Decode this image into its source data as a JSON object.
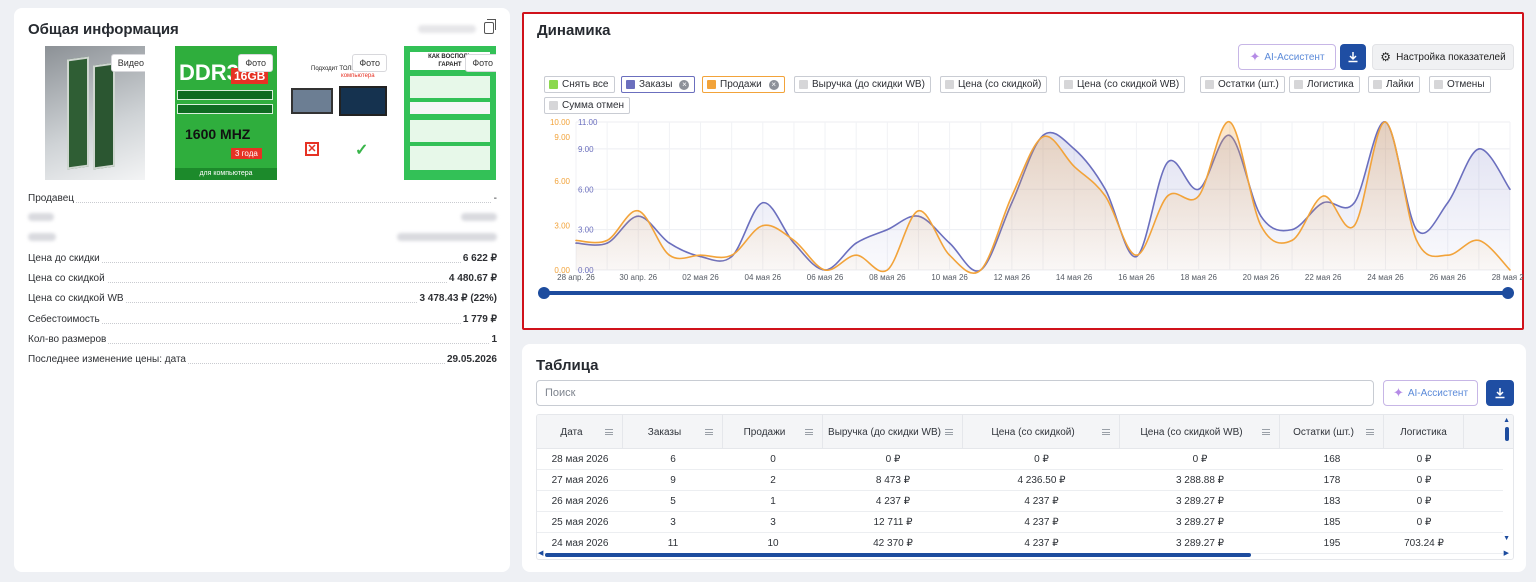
{
  "info": {
    "title": "Общая информация",
    "photos": [
      {
        "tag": "Видео"
      },
      {
        "tag": "Фото",
        "product_text": [
          "DDR3",
          "16GB",
          "1600 MHZ",
          "3 года",
          "для компьютера"
        ]
      },
      {
        "tag": "Фото",
        "product_text": [
          "Подходит ТОЛЬКО для",
          "компьютера"
        ]
      },
      {
        "tag": "Фото",
        "product_text": [
          "КАК ВОСПОЛЬ",
          "ГАРАНТ"
        ]
      }
    ],
    "rows": [
      {
        "label": "Продавец",
        "value": "-"
      },
      {
        "label": "",
        "value": "",
        "blurred": true
      },
      {
        "label": "",
        "value": "",
        "blurred": true
      },
      {
        "label": "Цена до скидки",
        "value": "6 622 ₽"
      },
      {
        "label": "Цена со скидкой",
        "value": "4 480.67 ₽"
      },
      {
        "label": "Цена со скидкой WB",
        "value": "3 478.43 ₽ (22%)"
      },
      {
        "label": "Себестоимость",
        "value": "1 779 ₽"
      },
      {
        "label": "Кол-во размеров",
        "value": "1"
      },
      {
        "label": "Последнее изменение цены: дата",
        "value": "29.05.2026"
      }
    ]
  },
  "dynamics": {
    "title": "Динамика",
    "ai_label": "AI-Ассистент",
    "settings_label": "Настройка показателей",
    "chips": [
      {
        "label": "Снять все",
        "color": "#8bd84e",
        "removable": false
      },
      {
        "label": "Заказы",
        "color": "#6b6fbe",
        "removable": true,
        "active": true
      },
      {
        "label": "Продажи",
        "color": "#f2a33a",
        "removable": true,
        "active": true
      },
      {
        "label": "Выручка (до скидки WB)",
        "color": "#d6d6d8",
        "removable": false
      },
      {
        "label": "Цена (со скидкой)",
        "color": "#d6d6d8",
        "removable": false
      },
      {
        "label": "Цена (со скидкой WB)",
        "color": "#d6d6d8",
        "removable": false
      },
      {
        "label": "Остатки (шт.)",
        "color": "#d6d6d8",
        "removable": false
      },
      {
        "label": "Логистика",
        "color": "#d6d6d8",
        "removable": false
      },
      {
        "label": "Лайки",
        "color": "#d6d6d8",
        "removable": false
      },
      {
        "label": "Отмены",
        "color": "#d6d6d8",
        "removable": false
      },
      {
        "label": "Сумма отмен",
        "color": "#d6d6d8",
        "removable": false
      }
    ]
  },
  "chart_data": {
    "type": "line",
    "x": [
      "28 апр. 26",
      "29 апр. 26",
      "30 апр. 26",
      "01 мая 26",
      "02 мая 26",
      "03 мая 26",
      "04 мая 26",
      "05 мая 26",
      "06 мая 26",
      "07 мая 26",
      "08 мая 26",
      "09 мая 26",
      "10 мая 26",
      "11 мая 26",
      "12 мая 26",
      "13 мая 26",
      "14 мая 26",
      "15 мая 26",
      "16 мая 26",
      "17 мая 26",
      "18 мая 26",
      "19 мая 26",
      "20 мая 26",
      "21 мая 26",
      "22 мая 26",
      "23 мая 26",
      "24 мая 26",
      "25 мая 26",
      "26 мая 26",
      "27 мая 26",
      "28 мая 26"
    ],
    "x_tick_labels": [
      "28 апр. 26",
      "30 апр. 26",
      "02 мая 26",
      "04 мая 26",
      "06 мая 26",
      "08 мая 26",
      "10 мая 26",
      "12 мая 26",
      "14 мая 26",
      "16 мая 26",
      "18 мая 26",
      "20 мая 26",
      "22 мая 26",
      "24 мая 26",
      "26 мая 26",
      "28 мая 26"
    ],
    "series": [
      {
        "name": "Заказы",
        "color": "#6b6fbe",
        "axis": "right",
        "values": [
          2,
          2,
          4,
          2,
          1,
          1,
          5,
          2,
          0,
          2,
          3,
          4,
          2,
          0,
          5,
          10,
          9,
          6,
          1,
          8,
          6,
          10,
          4,
          3,
          5,
          5,
          11,
          3,
          5,
          9,
          6
        ]
      },
      {
        "name": "Продажи",
        "color": "#f2a33a",
        "axis": "left",
        "values": [
          2,
          2,
          4,
          1,
          1,
          1,
          3,
          2,
          0,
          1,
          0,
          4,
          1,
          0,
          5,
          9,
          7,
          5,
          1,
          5,
          5,
          10,
          3,
          2,
          5,
          3,
          10,
          2,
          1,
          2,
          0
        ]
      }
    ],
    "y_left": {
      "ticks": [
        "0.00",
        "3.00",
        "6.00",
        "9.00",
        "10.00"
      ],
      "color": "#f2a33a",
      "range": [
        0,
        10
      ]
    },
    "y_right": {
      "ticks": [
        "0.00",
        "3.00",
        "6.00",
        "9.00",
        "11.00"
      ],
      "color": "#6b6fbe",
      "range": [
        0,
        11
      ]
    },
    "grid": true,
    "range_slider": true
  },
  "table": {
    "title": "Таблица",
    "search_placeholder": "Поиск",
    "ai_label": "AI-Ассистент",
    "columns": [
      "Дата",
      "Заказы",
      "Продажи",
      "Выручка (до скидки WB)",
      "Цена (со скидкой)",
      "Цена (со скидкой WB)",
      "Остатки (шт.)",
      "Логистика"
    ],
    "rows": [
      [
        "28 мая 2026",
        "6",
        "0",
        "0 ₽",
        "0 ₽",
        "0 ₽",
        "168",
        "0 ₽"
      ],
      [
        "27 мая 2026",
        "9",
        "2",
        "8 473 ₽",
        "4 236.50 ₽",
        "3 288.88 ₽",
        "178",
        "0 ₽"
      ],
      [
        "26 мая 2026",
        "5",
        "1",
        "4 237 ₽",
        "4 237 ₽",
        "3 289.27 ₽",
        "183",
        "0 ₽"
      ],
      [
        "25 мая 2026",
        "3",
        "3",
        "12 711 ₽",
        "4 237 ₽",
        "3 289.27 ₽",
        "185",
        "0 ₽"
      ],
      [
        "24 мая 2026",
        "11",
        "10",
        "42 370 ₽",
        "4 237 ₽",
        "3 289.27 ₽",
        "195",
        "703.24 ₽"
      ]
    ]
  }
}
